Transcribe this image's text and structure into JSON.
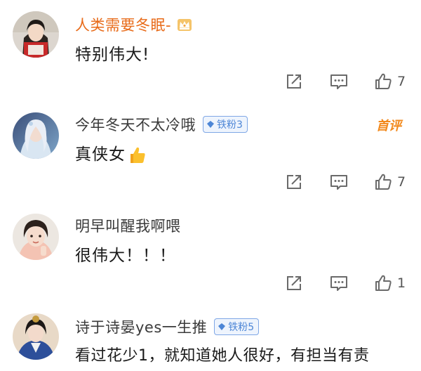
{
  "comments": [
    {
      "username": "人类需要冬眠-",
      "text": "特别伟大!",
      "likes": "7",
      "vip": true
    },
    {
      "username": "今年冬天不太冷哦",
      "badge": "铁粉3",
      "hot_label": "首评",
      "text": "真侠女",
      "likes": "7"
    },
    {
      "username": "明早叫醒我啊喂",
      "text": "很伟大！！！",
      "likes": "1"
    },
    {
      "username": "诗于诗晏yes一生推",
      "badge": "铁粉5",
      "text": "看过花少1，就知道她人很好，有担当有责"
    }
  ],
  "colors": {
    "vip_name": "#e86b1a",
    "hot_label": "#f2891c",
    "badge_blue": "#4d86d6",
    "icon_gray": "#6a6a6a"
  }
}
